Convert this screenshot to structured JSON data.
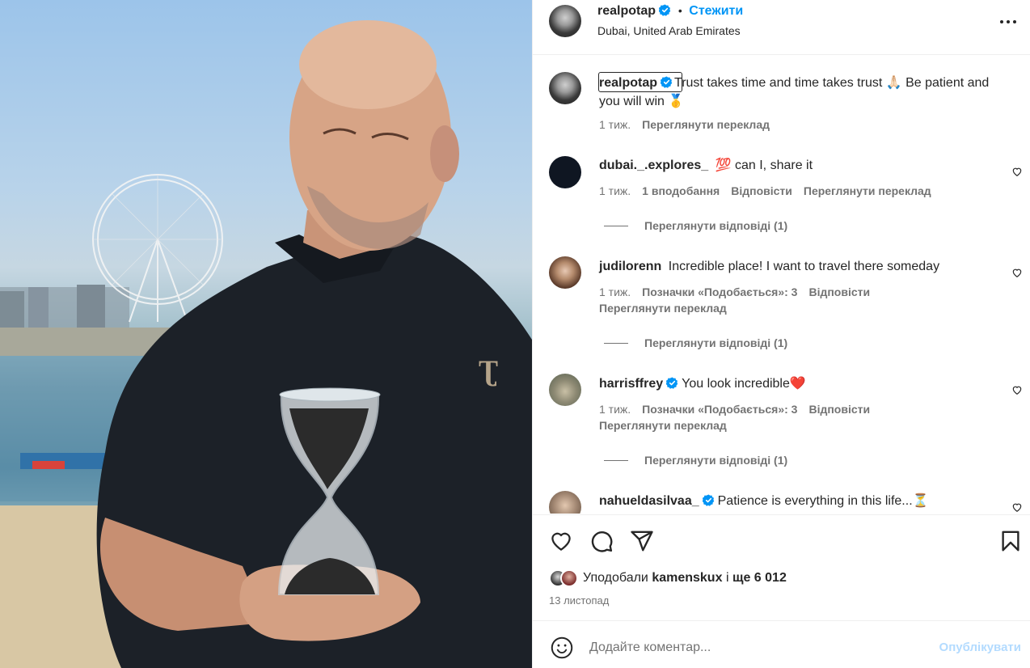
{
  "post": {
    "image_alt": "Photo",
    "author": {
      "username": "realpotap",
      "verified": true
    },
    "follow_label": "Стежити",
    "location": "Dubai, United Arab Emirates",
    "caption": {
      "username": "realpotap",
      "text": "Trust takes time and time takes trust 🙏🏻 Be patient and you will win 🥇",
      "time": "1 тиж.",
      "translate": "Переглянути переклад"
    },
    "comments": [
      {
        "username": "dubai._.explores_",
        "verified": false,
        "text": "💯 can I, share it",
        "time": "1 тиж.",
        "likes": "1 вподобання",
        "reply": "Відповісти",
        "translate": "Переглянути переклад",
        "view_replies": "Переглянути відповіді (1)"
      },
      {
        "username": "judilorenn",
        "verified": false,
        "text": "Incredible place! I want to travel there someday",
        "time": "1 тиж.",
        "likes": "Позначки «Подобається»: 3",
        "reply": "Відповісти",
        "translate": "Переглянути переклад",
        "view_replies": "Переглянути відповіді (1)"
      },
      {
        "username": "harrisffrey",
        "verified": true,
        "text": "You look incredible❤️",
        "time": "1 тиж.",
        "likes": "Позначки «Подобається»: 3",
        "reply": "Відповісти",
        "translate": "Переглянути переклад",
        "view_replies": "Переглянути відповіді (1)"
      },
      {
        "username": "nahueldasilvaa_",
        "verified": true,
        "text": "Patience is everything in this life...⏳"
      }
    ],
    "liked_by": {
      "prefix": "Уподобали",
      "user": "kamenskux",
      "middle": "і",
      "rest": "ще 6 012"
    },
    "date": "13 листопад",
    "comment_input": {
      "placeholder": "Додайте коментар..."
    },
    "publish_label": "Опублікувати"
  },
  "colors": {
    "accent": "#0095f6",
    "text": "#262626",
    "secondary": "#737373",
    "publish_disabled": "#b3dbff"
  },
  "icons": [
    "more-icon",
    "heart-icon",
    "comment-icon",
    "share-icon",
    "bookmark-icon",
    "emoji-icon",
    "verified-icon"
  ]
}
